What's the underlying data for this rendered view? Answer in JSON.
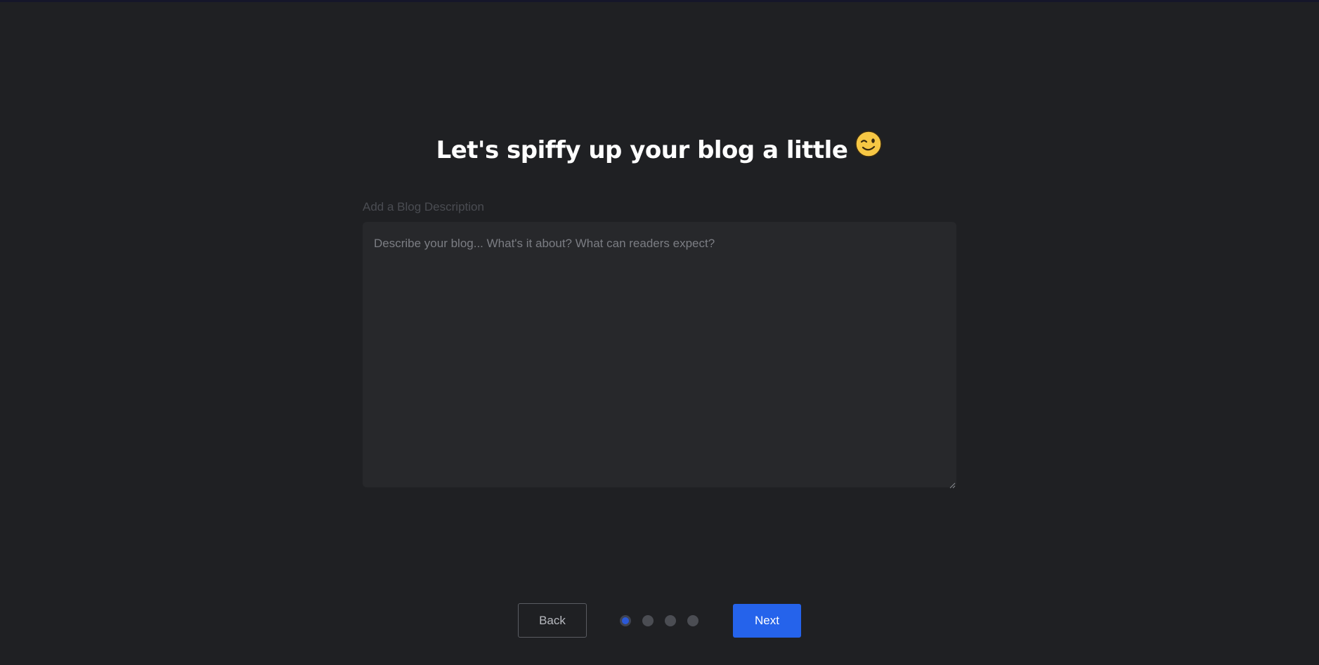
{
  "onboarding": {
    "title": "Let's spiffy up your blog a little",
    "title_icon": "winking-face-icon",
    "description_label": "Add a Blog Description",
    "description_value": "",
    "description_placeholder": "Describe your blog... What's it about? What can readers expect?"
  },
  "navigation": {
    "back_label": "Back",
    "next_label": "Next",
    "step_current": 1,
    "step_total": 4
  },
  "colors": {
    "background": "#1f2023",
    "input_background": "#27282b",
    "accent": "#2563eb",
    "inactive_dot": "#4b4d53"
  }
}
